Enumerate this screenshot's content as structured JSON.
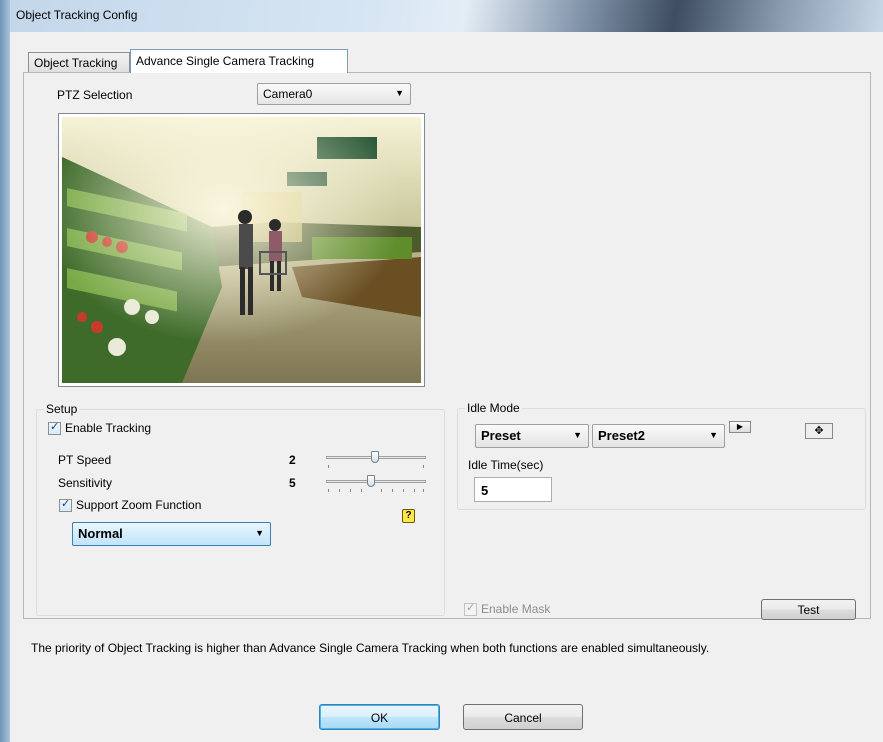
{
  "window": {
    "title": "Object Tracking Config"
  },
  "tabs": [
    {
      "label": "Object Tracking",
      "active": false
    },
    {
      "label": "Advance Single Camera Tracking",
      "active": true
    }
  ],
  "ptz": {
    "label": "PTZ Selection",
    "selected": "Camera0"
  },
  "setup": {
    "legend": "Setup",
    "enable_tracking_label": "Enable Tracking",
    "enable_tracking_checked": true,
    "pt_speed_label": "PT Speed",
    "pt_speed_value": "2",
    "sensitivity_label": "Sensitivity",
    "sensitivity_value": "5",
    "zoom_label": "Support Zoom Function",
    "zoom_checked": true,
    "zoom_mode": "Normal",
    "help_icon": "help-icon"
  },
  "idle": {
    "legend": "Idle Mode",
    "mode": "Preset",
    "preset": "Preset2",
    "idle_time_label": "Idle Time(sec)",
    "idle_time_value": "5"
  },
  "mask": {
    "label": "Enable Mask",
    "checked": true,
    "disabled": true
  },
  "test_label": "Test",
  "note": "The priority of Object Tracking is higher than Advance Single Camera Tracking when both functions are enabled simultaneously.",
  "ok_label": "OK",
  "cancel_label": "Cancel",
  "colors": {
    "accent": "#3c7fb1",
    "help_bg": "#ffe94a"
  }
}
